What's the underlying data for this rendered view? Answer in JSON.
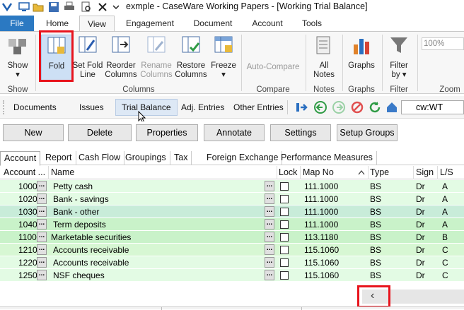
{
  "window": {
    "title": "exmple - CaseWare Working Papers - [Working Trial Balance]"
  },
  "menu_tabs": [
    {
      "label": "File"
    },
    {
      "label": "Home"
    },
    {
      "label": "View"
    },
    {
      "label": "Engagement"
    },
    {
      "label": "Document"
    },
    {
      "label": "Account"
    },
    {
      "label": "Tools"
    }
  ],
  "ribbon": {
    "show": {
      "label": "Show",
      "group": "Show"
    },
    "fold": {
      "label": "Fold"
    },
    "set_fold_line": {
      "label1": "Set Fold",
      "label2": "Line"
    },
    "reorder_columns": {
      "label1": "Reorder",
      "label2": "Columns"
    },
    "rename_columns": {
      "label1": "Rename",
      "label2": "Columns"
    },
    "restore_columns": {
      "label1": "Restore",
      "label2": "Columns"
    },
    "freeze": {
      "label": "Freeze"
    },
    "columns_group": "Columns",
    "auto_compare": {
      "label": "Auto-Compare"
    },
    "compare_group": "Compare",
    "all_notes": {
      "label1": "All",
      "label2": "Notes"
    },
    "notes_group": "Notes",
    "graphs": {
      "label": "Graphs"
    },
    "graphs_group": "Graphs",
    "filter_by": {
      "label1": "Filter",
      "label2": "by"
    },
    "filter_group": "Filter",
    "zoom_value": "100%",
    "zoom_group": "Zoom"
  },
  "nav": {
    "documents": "Documents",
    "issues": "Issues",
    "trial_balance": "Trial Balance",
    "adj_entries": "Adj. Entries",
    "other_entries": "Other Entries",
    "cw_field": "cw:WT"
  },
  "actions": {
    "new": "New",
    "delete": "Delete",
    "properties": "Properties",
    "annotate": "Annotate",
    "settings": "Settings",
    "setup_groups": "Setup Groups"
  },
  "sheet_tabs": [
    "Account",
    "Report",
    "Cash Flow",
    "Groupings",
    "Tax",
    "Foreign Exchange",
    "Performance Measures"
  ],
  "columns": {
    "account": "Account ...",
    "name": "Name",
    "lock": "Lock",
    "map_no": "Map No",
    "type": "Type",
    "sign": "Sign",
    "ls": "L/S"
  },
  "rows": [
    {
      "account": "1000",
      "name": "Petty cash",
      "map_no": "111.1000",
      "type": "BS",
      "sign": "Dr",
      "ls": "A"
    },
    {
      "account": "1020",
      "name": "Bank - savings",
      "map_no": "111.1000",
      "type": "BS",
      "sign": "Dr",
      "ls": "A"
    },
    {
      "account": "1030",
      "name": "Bank - other",
      "map_no": "111.1000",
      "type": "BS",
      "sign": "Dr",
      "ls": "A"
    },
    {
      "account": "1040",
      "name": "Term deposits",
      "map_no": "111.1000",
      "type": "BS",
      "sign": "Dr",
      "ls": "A"
    },
    {
      "account": "1100",
      "name": "Marketable securities",
      "map_no": "113.1180",
      "type": "BS",
      "sign": "Dr",
      "ls": "B"
    },
    {
      "account": "1210",
      "name": "Accounts receivable",
      "map_no": "115.1060",
      "type": "BS",
      "sign": "Dr",
      "ls": "C"
    },
    {
      "account": "1220",
      "name": "Accounts receivable",
      "map_no": "115.1060",
      "type": "BS",
      "sign": "Dr",
      "ls": "C"
    },
    {
      "account": "1250",
      "name": "NSF cheques",
      "map_no": "115.1060",
      "type": "BS",
      "sign": "Dr",
      "ls": "C"
    }
  ],
  "dots_label": "...",
  "scroll_left_glyph": "‹"
}
